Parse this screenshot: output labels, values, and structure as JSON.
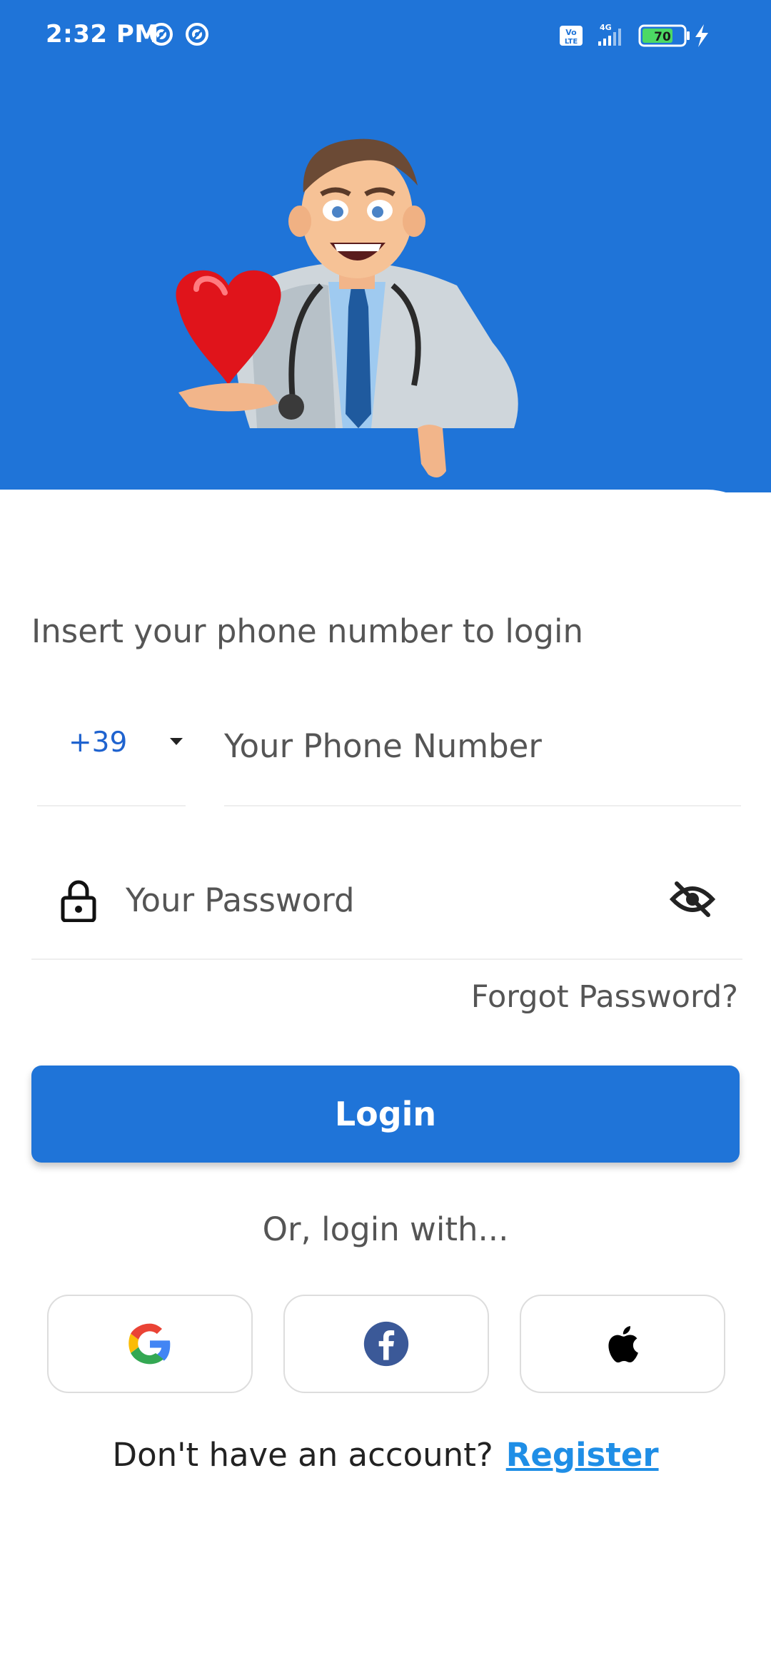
{
  "status_bar": {
    "time": "2:32 PM",
    "network": "4G",
    "volte": "Vo LTE",
    "battery": "70",
    "left_icons": [
      "at-sign-icon",
      "at-sign-icon"
    ],
    "right_icons": [
      "volte-icon",
      "signal-icon",
      "battery-icon",
      "charging-icon"
    ]
  },
  "colors": {
    "primary": "#1f74d8",
    "link": "#1f8ee6",
    "country_code": "#1f63cf"
  },
  "illustration": {
    "icon": "doctor-with-heart-illustration"
  },
  "form": {
    "instruction": "Insert your phone number to login",
    "country_code": "+39",
    "phone_placeholder": "Your Phone Number",
    "password_placeholder": "Your Password",
    "lock_icon": "lock-icon",
    "visibility_icon": "eye-off-icon",
    "forgot_password": "Forgot Password?",
    "login_button": "Login"
  },
  "social": {
    "label": "Or, login with...",
    "providers": [
      "google-icon",
      "facebook-icon",
      "apple-icon"
    ]
  },
  "register": {
    "prompt": "Don't have an account?",
    "link": "Register"
  }
}
